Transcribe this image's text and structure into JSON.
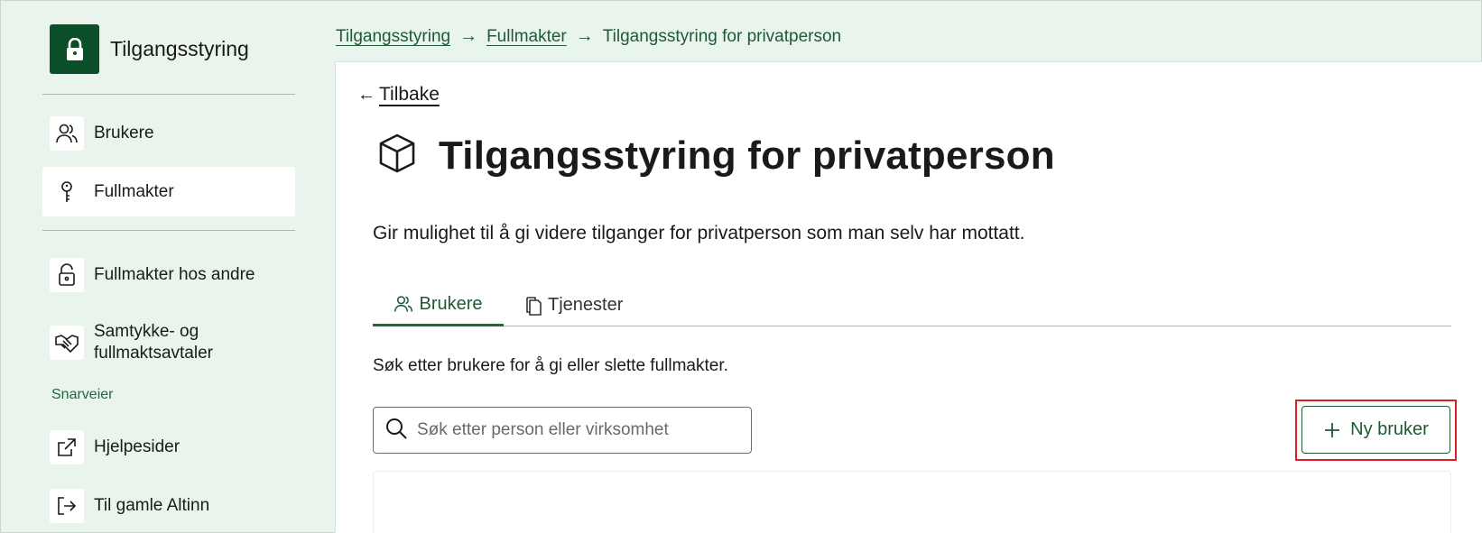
{
  "sidebar": {
    "brand_title": "Tilgangsstyring",
    "items": [
      {
        "label": "Brukere"
      },
      {
        "label": "Fullmakter"
      },
      {
        "label": "Fullmakter hos andre"
      },
      {
        "label": "Samtykke- og fullmaktsavtaler"
      }
    ],
    "shortcuts_label": "Snarveier",
    "shortcuts": [
      {
        "label": "Hjelpesider"
      },
      {
        "label": "Til gamle Altinn"
      }
    ]
  },
  "breadcrumb": {
    "items": [
      "Tilgangsstyring",
      "Fullmakter"
    ],
    "current": "Tilgangsstyring for privatperson"
  },
  "main": {
    "back_label": "Tilbake",
    "title": "Tilgangsstyring for privatperson",
    "description": "Gir mulighet til å gi videre tilganger for privatperson som man selv har mottatt.",
    "tabs": [
      {
        "label": "Brukere",
        "active": true
      },
      {
        "label": "Tjenester",
        "active": false
      }
    ],
    "hint": "Søk etter brukere for å gi eller slette fullmakter.",
    "search_placeholder": "Søk etter person eller virksomhet",
    "search_value": "",
    "new_user_label": "Ny bruker"
  },
  "colors": {
    "accent": "#1e6b3c",
    "brand": "#0b4f28",
    "sidebar_bg": "#e8f4ec",
    "highlight": "#e02020"
  }
}
